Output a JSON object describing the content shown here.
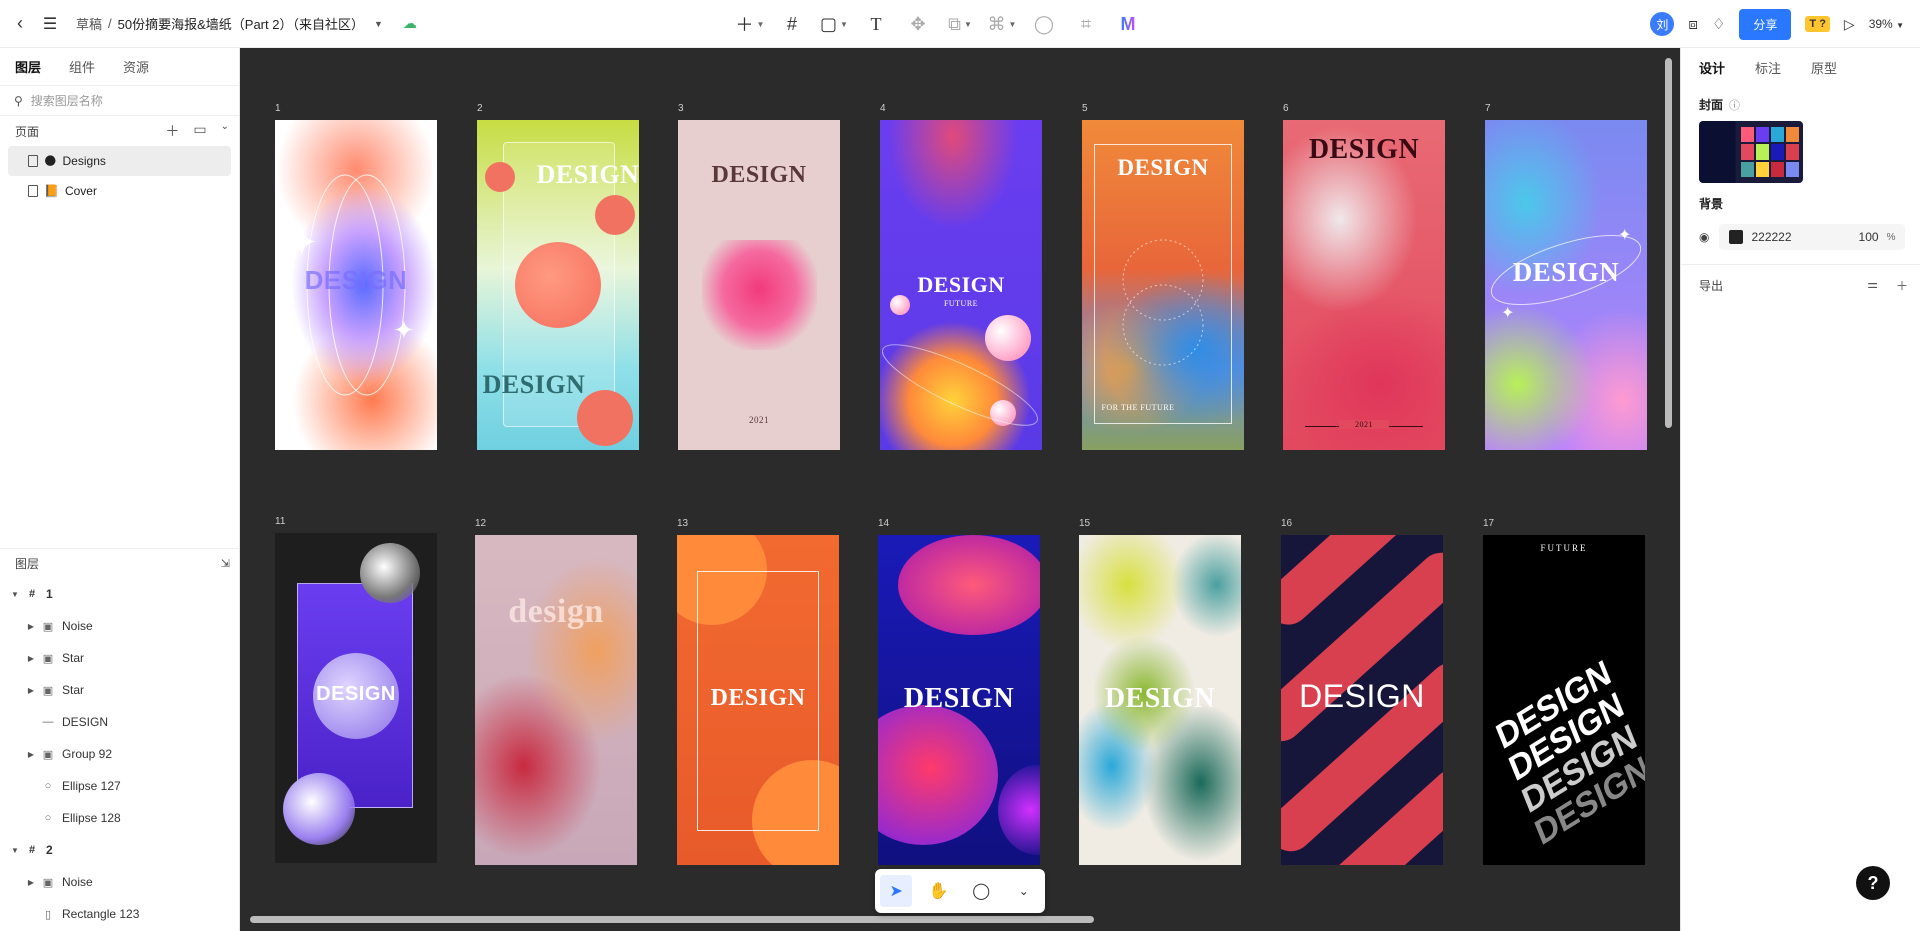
{
  "topbar": {
    "breadcrumb_root": "草稿",
    "breadcrumb_sep": "/",
    "file_name": "50份摘要海报&墙纸（Part 2）（来自社区）",
    "avatar": "刘",
    "share_label": "分享",
    "badge": "T ?",
    "zoom": "39%"
  },
  "left_panel": {
    "tabs": [
      "图层",
      "组件",
      "资源"
    ],
    "search_placeholder": "搜索图层名称",
    "pages_title": "页面",
    "pages": [
      {
        "emoji": "🌑",
        "label": "Designs"
      },
      {
        "emoji": "📙",
        "label": "Cover"
      }
    ],
    "layers_title": "图层",
    "layers": [
      {
        "label": "1",
        "icon": "frame-icon",
        "level": 0,
        "expanded": true
      },
      {
        "label": "Noise",
        "icon": "image-icon",
        "level": 1,
        "expanded": false
      },
      {
        "label": "Star",
        "icon": "image-icon",
        "level": 1,
        "expanded": false
      },
      {
        "label": "Star",
        "icon": "image-icon",
        "level": 1,
        "expanded": false
      },
      {
        "label": "DESIGN",
        "icon": "text-icon",
        "level": 1,
        "expanded": null
      },
      {
        "label": "Group 92",
        "icon": "image-icon",
        "level": 1,
        "expanded": false
      },
      {
        "label": "Ellipse 127",
        "icon": "ellipse-icon",
        "level": 1,
        "expanded": null
      },
      {
        "label": "Ellipse 128",
        "icon": "ellipse-icon",
        "level": 1,
        "expanded": null
      },
      {
        "label": "2",
        "icon": "frame-icon",
        "level": 0,
        "expanded": true
      },
      {
        "label": "Noise",
        "icon": "image-icon",
        "level": 1,
        "expanded": false
      },
      {
        "label": "Rectangle 123",
        "icon": "rectangle-icon",
        "level": 1,
        "expanded": null
      }
    ]
  },
  "canvas": {
    "artboards": [
      {
        "num": "1",
        "text": "DESIGN",
        "sub": ""
      },
      {
        "num": "2",
        "text": "DESIGN",
        "sub": "DESIGN"
      },
      {
        "num": "3",
        "text": "DESIGN",
        "sub": "2021"
      },
      {
        "num": "4",
        "text": "DESIGN",
        "sub": "FUTURE"
      },
      {
        "num": "5",
        "text": "DESIGN",
        "sub": "FOR THE FUTURE"
      },
      {
        "num": "6",
        "text": "DESIGN",
        "sub": "2021"
      },
      {
        "num": "7",
        "text": "DESIGN",
        "sub": ""
      },
      {
        "num": "11",
        "text": "DESIGN",
        "sub": ""
      },
      {
        "num": "12",
        "text": "design",
        "sub": ""
      },
      {
        "num": "13",
        "text": "DESIGN",
        "sub": ""
      },
      {
        "num": "14",
        "text": "DESIGN",
        "sub": ""
      },
      {
        "num": "15",
        "text": "DESIGN",
        "sub": ""
      },
      {
        "num": "16",
        "text": "DESIGN",
        "sub": ""
      },
      {
        "num": "17",
        "text": "DESIGN",
        "sub": "FUTURE"
      }
    ]
  },
  "right_panel": {
    "tabs": [
      "设计",
      "标注",
      "原型"
    ],
    "cover_label": "封面",
    "background_label": "背景",
    "bg_hex": "222222",
    "bg_opacity": "100",
    "bg_unit": "%",
    "export_label": "导出"
  }
}
